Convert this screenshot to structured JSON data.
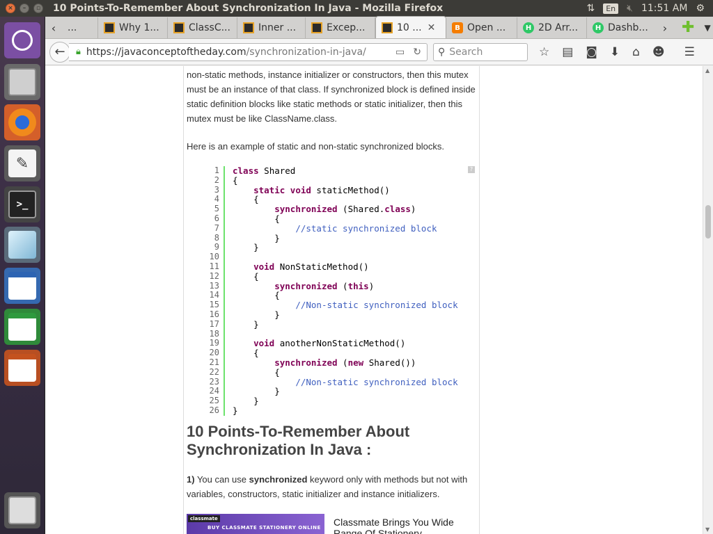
{
  "window": {
    "title": "10 Points-To-Remember About Synchronization In Java - Mozilla Firefox",
    "clock": "11:51 AM",
    "keyboard_layout": "En"
  },
  "tabs": [
    {
      "label": "...",
      "icon": "javaconcept-icon"
    },
    {
      "label": "Why 1...",
      "icon": "javaconcept-icon"
    },
    {
      "label": "ClassC...",
      "icon": "javaconcept-icon"
    },
    {
      "label": "Inner ...",
      "icon": "javaconcept-icon"
    },
    {
      "label": "Excep...",
      "icon": "javaconcept-icon"
    },
    {
      "label": "10 ...",
      "icon": "javaconcept-icon",
      "active": true
    },
    {
      "label": "Open ...",
      "icon": "blogger-icon"
    },
    {
      "label": "2D Arr...",
      "icon": "hackerrank-icon"
    },
    {
      "label": "Dashb...",
      "icon": "hackerrank-icon"
    }
  ],
  "nav": {
    "url_host": "https://javaconceptoftheday.com",
    "url_path": "/synchronization-in-java/",
    "search_placeholder": "Search"
  },
  "article": {
    "para1": "non-static methods, instance initializer or constructors, then this mutex must be an instance of that class. If synchronized block is defined inside static definition blocks like static methods or static initializer, then this mutex must be like ClassName.class.",
    "para2": "Here is an example of static and non-static synchronized blocks.",
    "code": [
      {
        "n": "1",
        "html": "<span class='kw'>class</span> Shared"
      },
      {
        "n": "2",
        "html": "{"
      },
      {
        "n": "3",
        "html": "    <span class='kw'>static</span> <span class='kw'>void</span> staticMethod()"
      },
      {
        "n": "4",
        "html": "    {"
      },
      {
        "n": "5",
        "html": "        <span class='kw'>synchronized</span> (Shared.<span class='kw'>class</span>)"
      },
      {
        "n": "6",
        "html": "        {"
      },
      {
        "n": "7",
        "html": "            <span class='cm'>//static synchronized block</span>"
      },
      {
        "n": "8",
        "html": "        }"
      },
      {
        "n": "9",
        "html": "    }"
      },
      {
        "n": "10",
        "html": ""
      },
      {
        "n": "11",
        "html": "    <span class='kw'>void</span> NonStaticMethod()"
      },
      {
        "n": "12",
        "html": "    {"
      },
      {
        "n": "13",
        "html": "        <span class='kw'>synchronized</span> (<span class='kw'>this</span>)"
      },
      {
        "n": "14",
        "html": "        {"
      },
      {
        "n": "15",
        "html": "            <span class='cm'>//Non-static synchronized block</span>"
      },
      {
        "n": "16",
        "html": "        }"
      },
      {
        "n": "17",
        "html": "    }"
      },
      {
        "n": "18",
        "html": ""
      },
      {
        "n": "19",
        "html": "    <span class='kw'>void</span> anotherNonStaticMethod()"
      },
      {
        "n": "20",
        "html": "    {"
      },
      {
        "n": "21",
        "html": "        <span class='kw'>synchronized</span> (<span class='kw'>new</span> Shared())"
      },
      {
        "n": "22",
        "html": "        {"
      },
      {
        "n": "23",
        "html": "            <span class='cm'>//Non-static synchronized block</span>"
      },
      {
        "n": "24",
        "html": "        }"
      },
      {
        "n": "25",
        "html": "    }"
      },
      {
        "n": "26",
        "html": "}"
      }
    ],
    "heading": "10 Points-To-Remember About Synchronization In Java :",
    "point1_num": "1)",
    "point1_pre": " You can use ",
    "point1_bold": "synchronized",
    "point1_post": " keyword only with methods but not with variables, constructors, static initializer and instance initializers.",
    "ad_badge": "classmate",
    "ad_tagline": "BUY CLASSMATE STATIONERY ONLINE",
    "ad_text": "Classmate Brings You Wide Range Of Stationery"
  }
}
